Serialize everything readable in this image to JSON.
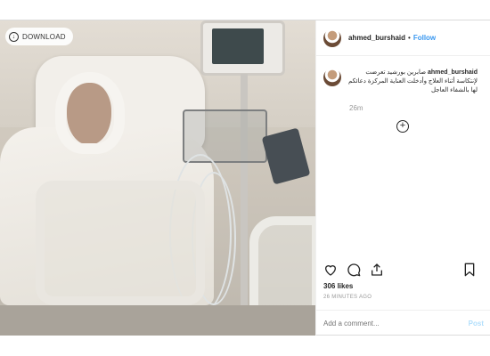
{
  "download": {
    "label": "DOWNLOAD",
    "icon": "download-icon"
  },
  "post": {
    "username": "ahmed_burshaid",
    "separator": "•",
    "follow_label": "Follow",
    "caption_user": "ahmed_burshaid",
    "caption_line1": "صابرين بورشيد تعرضت",
    "caption_line2": "لإنتكاسة أثناء العلاج وأدخلت العناية المركزة دعائكم",
    "caption_line3": "لها بالشفاء العاجل",
    "time": "26m",
    "likes": "306 likes",
    "ago": "26 MINUTES AGO",
    "add_comment_placeholder": "Add a comment...",
    "post_label": "Post"
  },
  "colors": {
    "accent": "#3897f0",
    "post_disabled": "#b2dffc"
  }
}
